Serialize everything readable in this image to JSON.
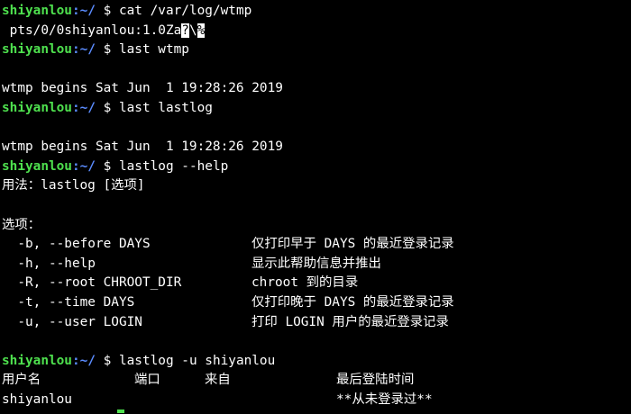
{
  "prompt": {
    "user": "shiyanlou",
    "path": ":~/",
    "sign": " $ "
  },
  "lines": {
    "l1_cmd": "cat /var/log/wtmp",
    "l2_out_a": " pts/0/0shiyanlou:1.0Za",
    "l2_out_b": "\\",
    "l2_glyph1": "?",
    "l2_glyph2": "%",
    "l3_cmd": "last wtmp",
    "l5_out": "wtmp begins Sat Jun  1 19:28:26 2019",
    "l6_cmd": "last lastlog",
    "l8_out": "wtmp begins Sat Jun  1 19:28:26 2019",
    "l9_cmd": "lastlog --help",
    "l10_out": "用法：lastlog [选项]",
    "l12_out": "选项：",
    "l18_cmd": "lastlog -u shiyanlou"
  },
  "options": [
    {
      "flag": "  -b, --before DAYS",
      "desc": "仅打印早于 DAYS 的最近登录记录"
    },
    {
      "flag": "  -h, --help",
      "desc": "显示此帮助信息并推出"
    },
    {
      "flag": "  -R, --root CHROOT_DIR",
      "desc": "chroot 到的目录"
    },
    {
      "flag": "  -t, --time DAYS",
      "desc": "仅打印晚于 DAYS 的最近登录记录"
    },
    {
      "flag": "  -u, --user LOGIN",
      "desc": "打印 LOGIN 用户的最近登录记录"
    }
  ],
  "lastlog_table": {
    "headers": [
      "用户名",
      "端口",
      "来自",
      "最后登陆时间"
    ],
    "rows": [
      [
        "shiyanlou",
        "",
        "",
        "**从未登录过**"
      ]
    ]
  },
  "colors": {
    "background": "#000000",
    "text": "#ffffff",
    "prompt_user": "#4ee04e",
    "prompt_path": "#5b8cff"
  }
}
